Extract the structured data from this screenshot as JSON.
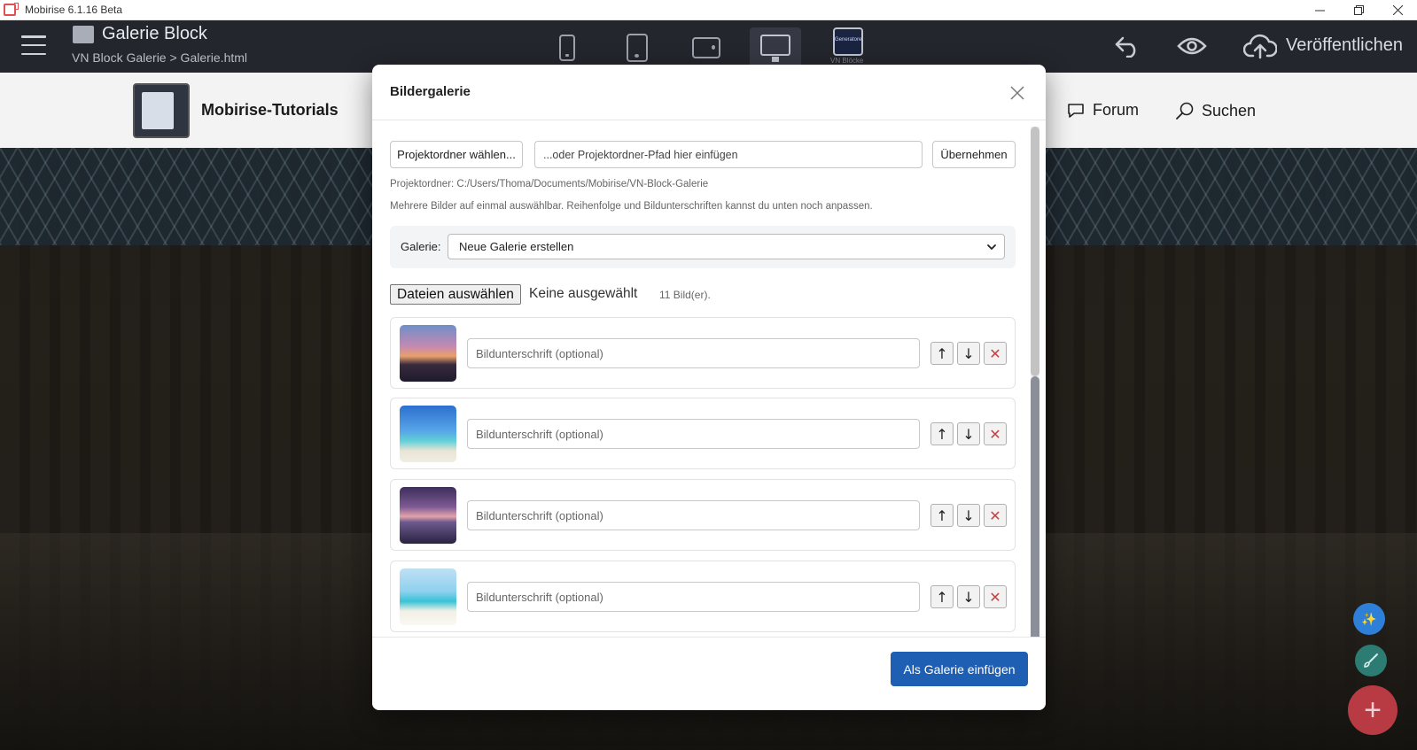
{
  "os_window": {
    "title": "Mobirise 6.1.16 Beta",
    "controls": [
      "minimize",
      "restore",
      "close"
    ]
  },
  "toolbar": {
    "page_title": "Galerie Block",
    "page_path": "VN Block Galerie > Galerie.html",
    "devices": [
      "phone",
      "tablet",
      "tablet-landscape",
      "desktop"
    ],
    "active_device": "desktop",
    "vn_blocks_label": "VN Blöcke",
    "vn_blocks_icon_text": "Generatoren",
    "publish_label": "Veröffentlichen"
  },
  "site": {
    "brand": "Mobirise-Tutorials",
    "nav": [
      "Forum",
      "Suchen"
    ]
  },
  "modal": {
    "title": "Bildergalerie",
    "choose_folder_label": "Projektordner wählen...",
    "path_placeholder": "...oder Projektordner-Pfad hier einfügen",
    "apply_label": "Übernehmen",
    "folder_info": "Projektordner: C:/Users/Thoma/Documents/Mobirise/VN-Block-Galerie",
    "multi_hint": "Mehrere Bilder auf einmal auswählbar. Reihenfolge und Bildunterschriften kannst du unten noch anpassen.",
    "gallery_label": "Galerie:",
    "gallery_selected": "Neue Galerie erstellen",
    "file_button_label": "Dateien auswählen",
    "file_none_label": "Keine ausgewählt",
    "image_count": "11 Bild(er).",
    "caption_placeholder": "Bildunterschrift (optional)",
    "move_up_symbol": "↑",
    "move_down_symbol": "↓",
    "delete_symbol": "✕",
    "images": [
      {
        "thumb": "sunset-clouds"
      },
      {
        "thumb": "palm-beach-hammock"
      },
      {
        "thumb": "purple-sunset-sea"
      },
      {
        "thumb": "palm-white-beach"
      }
    ],
    "insert_label": "Als Galerie einfügen"
  },
  "colors": {
    "toolbar_bg": "#24262d",
    "primary_button": "#1f5fb3",
    "delete_red": "#c94040",
    "fab_add": "#b83b44",
    "fab_spark": "#2e7fd8",
    "fab_brush": "#2c7c74"
  }
}
